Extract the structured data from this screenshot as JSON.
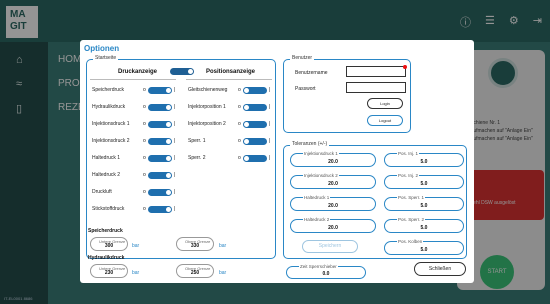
{
  "app": {
    "logo_line1": "MA",
    "logo_line2": "GIT",
    "menu": [
      "HOME",
      "PROZ",
      "REZEI"
    ],
    "right_panel": {
      "line1": "Schiene Nr. 1",
      "line2": "Aufmachen auf \"Anlage Ein\"",
      "line3": "Aufmachen auf \"Anlage Ein\"",
      "warning": "Fehl DSW ausgelöst",
      "start": "START"
    },
    "footer": "IT-EL0001 8686"
  },
  "dialog": {
    "title": "Optionen",
    "startseite": {
      "legend": "Startseite",
      "header_left": "Druckanzeige",
      "header_right": "Positionsanzeige",
      "left_items": [
        "Speicherdruck",
        "Hydraulikdruck",
        "Injektionsdruck 1",
        "Injektionsdruck 2",
        "Haltedruck 1",
        "Haltedruck 2",
        "Druckluft",
        "Stickstoffdruck"
      ],
      "right_items": [
        "Gleitschienenweg",
        "Injektorposition 1",
        "Injektorposition 2",
        "Sperr. 1",
        "Sperr. 2"
      ],
      "off_label": "o"
    },
    "speicherdruck": {
      "title": "Speicherdruck",
      "unter_label": "Untere Grenze",
      "unter_value": "300",
      "ober_label": "Obere Grenze",
      "ober_value": "330",
      "unit": "bar"
    },
    "hydraulikdruck": {
      "title": "Hydraulikdruck",
      "unter_label": "Untere Grenze",
      "unter_value": "230",
      "ober_label": "Obere Grenze",
      "ober_value": "250",
      "unit": "bar"
    },
    "benutzer": {
      "legend": "Benutzer",
      "username_label": "Benutzername",
      "password_label": "Passwort",
      "login": "Login",
      "logout": "Logout"
    },
    "toleranzen": {
      "legend": "Toleranzen (+/-)",
      "left": [
        {
          "label": "Injektionsdruck 1",
          "value": "20.0"
        },
        {
          "label": "Injektionsdruck 2",
          "value": "20.0"
        },
        {
          "label": "Haltedruck 1",
          "value": "20.0"
        },
        {
          "label": "Haltedruck 2",
          "value": "20.0"
        }
      ],
      "right": [
        {
          "label": "Pos. Inj. 1",
          "value": "5.0"
        },
        {
          "label": "Pos. Inj. 2",
          "value": "5.0"
        },
        {
          "label": "Pos. Sperr. 1",
          "value": "5.0"
        },
        {
          "label": "Pos. Sperr. 2",
          "value": "5.0"
        },
        {
          "label": "Pos. Kolben",
          "value": "5.0"
        }
      ],
      "save": "Speichern"
    },
    "zeit": {
      "label": "Zeit Sperrschieber",
      "value": "0.0"
    },
    "close": "Schließen"
  }
}
